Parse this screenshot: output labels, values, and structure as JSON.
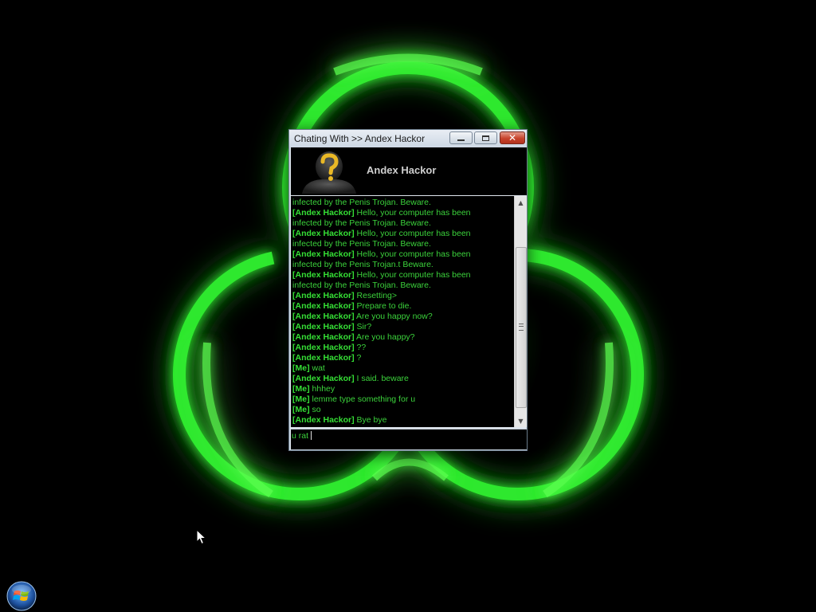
{
  "window": {
    "title": "Chating With >> Andex Hackor",
    "contact_name": "Andex Hackor",
    "avatar_icon": "question-mark-avatar-icon"
  },
  "messages": [
    {
      "sender": "",
      "text": "infected by the Penis Trojan. Beware."
    },
    {
      "sender": "[Andex Hackor]",
      "text": " Hello, your computer has been"
    },
    {
      "sender": "",
      "text": "infected by the Penis Trojan. Beware."
    },
    {
      "sender": "[Andex Hackor]",
      "text": " Hello, your computer has been"
    },
    {
      "sender": "",
      "text": "infected by the Penis Trojan. Beware."
    },
    {
      "sender": "[Andex Hackor]",
      "text": " Hello, your computer has been"
    },
    {
      "sender": "",
      "text": "infected by the Penis Trojan.t  Beware."
    },
    {
      "sender": "[Andex Hackor]",
      "text": " Hello, your computer has been"
    },
    {
      "sender": "",
      "text": "infected by the Penis Trojan. Beware."
    },
    {
      "sender": "[Andex Hackor]",
      "text": " Resetting>"
    },
    {
      "sender": "[Andex Hackor]",
      "text": " Prepare to die."
    },
    {
      "sender": "[Andex Hackor]",
      "text": " Are you happy now?"
    },
    {
      "sender": "[Andex Hackor]",
      "text": " Sir?"
    },
    {
      "sender": "[Andex Hackor]",
      "text": " Are you happy?"
    },
    {
      "sender": "[Andex Hackor]",
      "text": " ??"
    },
    {
      "sender": "[Andex Hackor]",
      "text": " ?"
    },
    {
      "sender": "[Me]",
      "text": " wat"
    },
    {
      "sender": "[Andex Hackor]",
      "text": " I said. beware"
    },
    {
      "sender": "[Me]",
      "text": " hhhey"
    },
    {
      "sender": "[Me]",
      "text": " lemme type something for u"
    },
    {
      "sender": "[Me]",
      "text": " so"
    },
    {
      "sender": "[Andex Hackor]",
      "text": " Bye bye"
    }
  ],
  "input": {
    "value": "u rat"
  },
  "colors": {
    "chat_text": "#3bd23b",
    "glow": "#39ff3a",
    "desktop_background": "#000000",
    "title_bar": "#dfe6ee",
    "close_button": "#c7432c"
  },
  "icons": {
    "start_button": "windows-start-orb-icon",
    "wallpaper": "biohazard-symbol"
  }
}
